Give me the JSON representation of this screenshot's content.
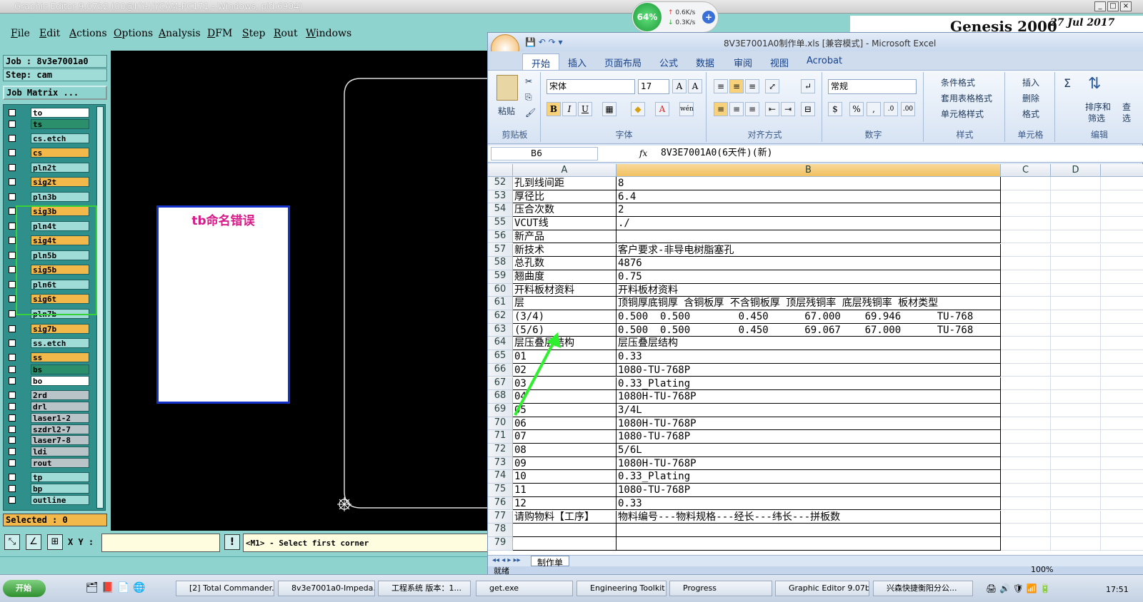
{
  "ge_window": {
    "title": "Graphic Editor 9.07b2 (00@HY-HYCAM-PC171 - Windows, pid:6904)",
    "menu": [
      "File",
      "Edit",
      "Actions",
      "Options",
      "Analysis",
      "DFM",
      "Step",
      "Rout",
      "Windows"
    ],
    "brand": "Genesis 2000",
    "date": "27 Jul 2017",
    "job": "Job : 8v3e7001a0",
    "step": "Step: cam",
    "job_matrix_label": "Job Matrix ...",
    "layers": [
      {
        "name": "to",
        "color": "#ffffff"
      },
      {
        "name": "ts",
        "color": "#2a8f6a"
      },
      {
        "name": "cs.etch",
        "color": "#9fdcd8"
      },
      {
        "name": "cs",
        "color": "#f2b84a"
      },
      {
        "name": "pln2t",
        "color": "#9fdcd8"
      },
      {
        "name": "sig2t",
        "color": "#f2b84a"
      },
      {
        "name": "pln3b",
        "color": "#9fdcd8"
      },
      {
        "name": "sig3b",
        "color": "#f2b84a"
      },
      {
        "name": "pln4t",
        "color": "#9fdcd8"
      },
      {
        "name": "sig4t",
        "color": "#f2b84a"
      },
      {
        "name": "pln5b",
        "color": "#9fdcd8"
      },
      {
        "name": "sig5b",
        "color": "#f2b84a"
      },
      {
        "name": "pln6t",
        "color": "#9fdcd8"
      },
      {
        "name": "sig6t",
        "color": "#f2b84a"
      },
      {
        "name": "pln7b",
        "color": "#9fdcd8"
      },
      {
        "name": "sig7b",
        "color": "#f2b84a"
      },
      {
        "name": "ss.etch",
        "color": "#9fdcd8"
      },
      {
        "name": "ss",
        "color": "#f2b84a"
      },
      {
        "name": "bs",
        "color": "#2a8f6a"
      },
      {
        "name": "bo",
        "color": "#ffffff"
      },
      {
        "name": "2rd",
        "color": "#b9c4c8"
      },
      {
        "name": "drl",
        "color": "#b9c4c8"
      },
      {
        "name": "laser1-2",
        "color": "#b9c4c8"
      },
      {
        "name": "szdrl2-7",
        "color": "#b9c4c8"
      },
      {
        "name": "laser7-8",
        "color": "#b9c4c8"
      },
      {
        "name": "ldi",
        "color": "#b9c4c8"
      },
      {
        "name": "rout",
        "color": "#b9c4c8"
      },
      {
        "name": "tp",
        "color": "#9fdcd8"
      },
      {
        "name": "bp",
        "color": "#9fdcd8"
      },
      {
        "name": "outline",
        "color": "#9fdcd8"
      }
    ],
    "selected": "Selected : 0",
    "xy_label": "X Y :",
    "prompt": "<M1> - Select first corner",
    "annotation": "tb命名错误"
  },
  "net_widget": {
    "cpu": "64%",
    "up": "0.6K/s",
    "down": "0.3K/s"
  },
  "excel": {
    "title": "8V3E7001A0制作单.xls [兼容模式] - Microsoft Excel",
    "tabs": [
      "开始",
      "插入",
      "页面布局",
      "公式",
      "数据",
      "审阅",
      "视图",
      "Acrobat"
    ],
    "groups": {
      "clipboard": "剪贴板",
      "paste": "粘贴",
      "font": "字体",
      "font_name": "宋体",
      "font_size": "17",
      "align": "对齐方式",
      "number": "数字",
      "number_format": "常规",
      "styles": "样式",
      "cond_fmt": "条件格式",
      "table_fmt": "套用表格格式",
      "cell_style": "单元格样式",
      "cells": "单元格",
      "insert": "插入",
      "delete": "删除",
      "format": "格式",
      "edit": "编辑",
      "sort": "排序和",
      "filter": "筛选",
      "find": "查",
      "find2": "选"
    },
    "name_box": "B6",
    "fx": "fx",
    "formula": "8V3E7001A0(6天件)(新)",
    "columns": [
      "A",
      "B",
      "C",
      "D"
    ],
    "rows": [
      {
        "n": "52",
        "a": "孔到线间距",
        "b": "8"
      },
      {
        "n": "53",
        "a": "厚径比",
        "b": "6.4"
      },
      {
        "n": "54",
        "a": "压合次数",
        "b": "2"
      },
      {
        "n": "55",
        "a": "VCUT线",
        "b": "./"
      },
      {
        "n": "56",
        "a": "新产品",
        "b": ""
      },
      {
        "n": "57",
        "a": "新技术",
        "b": "客户要求-非导电树脂塞孔"
      },
      {
        "n": "58",
        "a": "总孔数",
        "b": "4876"
      },
      {
        "n": "59",
        "a": "翘曲度",
        "b": "0.75"
      },
      {
        "n": "60",
        "a": "开料板材资料",
        "b": "开料板材资料"
      },
      {
        "n": "61",
        "a": "层",
        "b": "顶铜厚底铜厚 含铜板厚 不含铜板厚 顶层残铜率 底层残铜率 板材类型"
      },
      {
        "n": "62",
        "a": "(3/4)",
        "b": "0.500  0.500        0.450      67.000    69.946      TU-768"
      },
      {
        "n": "63",
        "a": "(5/6)",
        "b": "0.500  0.500        0.450      69.067    67.000      TU-768"
      },
      {
        "n": "64",
        "a": "层压叠层结构",
        "b": "层压叠层结构"
      },
      {
        "n": "65",
        "a": "01",
        "b": "0.33"
      },
      {
        "n": "66",
        "a": "02",
        "b": "1080-TU-768P"
      },
      {
        "n": "67",
        "a": "03",
        "b": "0.33_Plating"
      },
      {
        "n": "68",
        "a": "04",
        "b": "1080H-TU-768P"
      },
      {
        "n": "69",
        "a": "05",
        "b": "3/4L"
      },
      {
        "n": "70",
        "a": "06",
        "b": "1080H-TU-768P"
      },
      {
        "n": "71",
        "a": "07",
        "b": "1080-TU-768P"
      },
      {
        "n": "72",
        "a": "08",
        "b": "5/6L"
      },
      {
        "n": "73",
        "a": "09",
        "b": "1080H-TU-768P"
      },
      {
        "n": "74",
        "a": "10",
        "b": "0.33_Plating"
      },
      {
        "n": "75",
        "a": "11",
        "b": "1080-TU-768P"
      },
      {
        "n": "76",
        "a": "12",
        "b": "0.33"
      },
      {
        "n": "77",
        "a": "请购物料【工序】",
        "b": "物料编号---物料规格---经长---纬长---拼板数"
      },
      {
        "n": "78",
        "a": "",
        "b": ""
      },
      {
        "n": "79",
        "a": "",
        "b": ""
      }
    ],
    "sheet_tab": "制作单",
    "status": "就绪",
    "zoom": "100%"
  },
  "taskbar": {
    "start": "开始",
    "items": [
      "[2] Total Commander...",
      "8v3e7001a0-Impeda...",
      "工程系统  版本：1...",
      "get.exe",
      "Engineering Toolkit 9...",
      "Progress",
      "Graphic Editor 9.07b...",
      "兴森快捷衡阳分公..."
    ],
    "clock": "17:51"
  }
}
